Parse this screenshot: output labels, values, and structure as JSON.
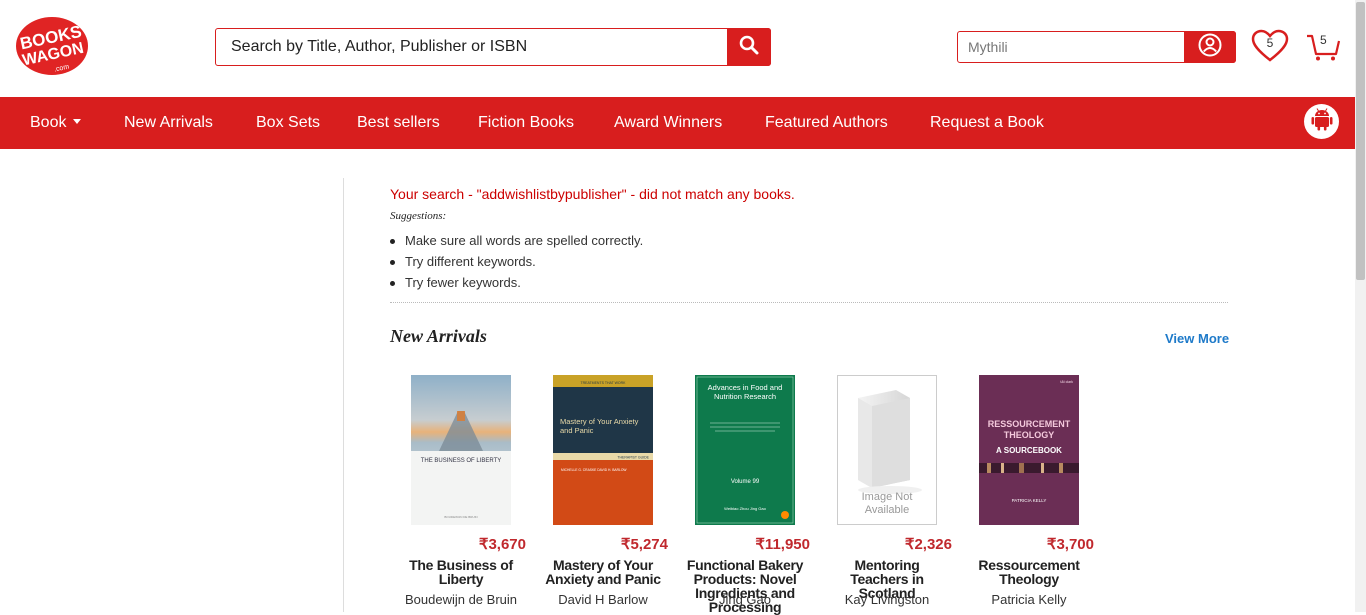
{
  "header": {
    "logo_text_line1": "BOOKS",
    "logo_text_line2": "WAGON",
    "logo_text_line3": ".com",
    "search_placeholder": "Search by Title, Author, Publisher or ISBN",
    "user_name": "Mythili",
    "wishlist_count": "5",
    "cart_count": "5",
    "brand_color": "#d81e1e"
  },
  "nav": {
    "items": [
      {
        "label": "Book",
        "has_dropdown": true
      },
      {
        "label": "New Arrivals"
      },
      {
        "label": "Box Sets"
      },
      {
        "label": "Best sellers"
      },
      {
        "label": "Fiction Books"
      },
      {
        "label": "Award Winners"
      },
      {
        "label": "Featured Authors"
      },
      {
        "label": "Request a Book"
      }
    ],
    "app_icon": "android-icon"
  },
  "search_result": {
    "message": "Your search - \"addwishlistbypublisher\" - did not match any books.",
    "suggestions_label": "Suggestions:",
    "suggestions": [
      "Make sure all words are spelled correctly.",
      "Try different keywords.",
      "Try fewer keywords."
    ]
  },
  "new_arrivals": {
    "title": "New Arrivals",
    "view_more": "View More",
    "books": [
      {
        "title": "The Business of Liberty",
        "author": "Boudewijn de Bruin",
        "price": "₹3,670",
        "cover_title": "THE BUSINESS OF LIBERTY",
        "cover_author": "BOUDEWIJN DE BRUIN"
      },
      {
        "title": "Mastery of Your Anxiety and Panic",
        "author": "David H Barlow",
        "price": "₹5,274",
        "cover_title": "Mastery of Your Anxiety and Panic",
        "cover_sub": "THERAPIST GUIDE",
        "cover_top": "TREATMENTS THAT WORK",
        "cover_author": "MICHELLE G. CRASKE  DAVID H. BARLOW"
      },
      {
        "title": "Functional Bakery Products: Novel Ingredients and Processing",
        "author": "Jing Gao",
        "price": "₹11,950",
        "cover_title": "Advances in Food and Nutrition Research",
        "cover_volume": "Volume 99",
        "cover_editors": "Weibiao Zhou Jing Gao"
      },
      {
        "title": "Mentoring Teachers in Scotland",
        "author": "Kay Livingston",
        "price": "₹2,326",
        "placeholder_text": "Image Not Available"
      },
      {
        "title": "Ressourcement Theology",
        "author": "Patricia Kelly",
        "price": "₹3,700",
        "cover_title": "RESSOURCEMENT THEOLOGY",
        "cover_sub": "A SOURCEBOOK",
        "cover_author": "PATRICIA KELLY",
        "cover_publisher": "t&t clark"
      }
    ]
  }
}
